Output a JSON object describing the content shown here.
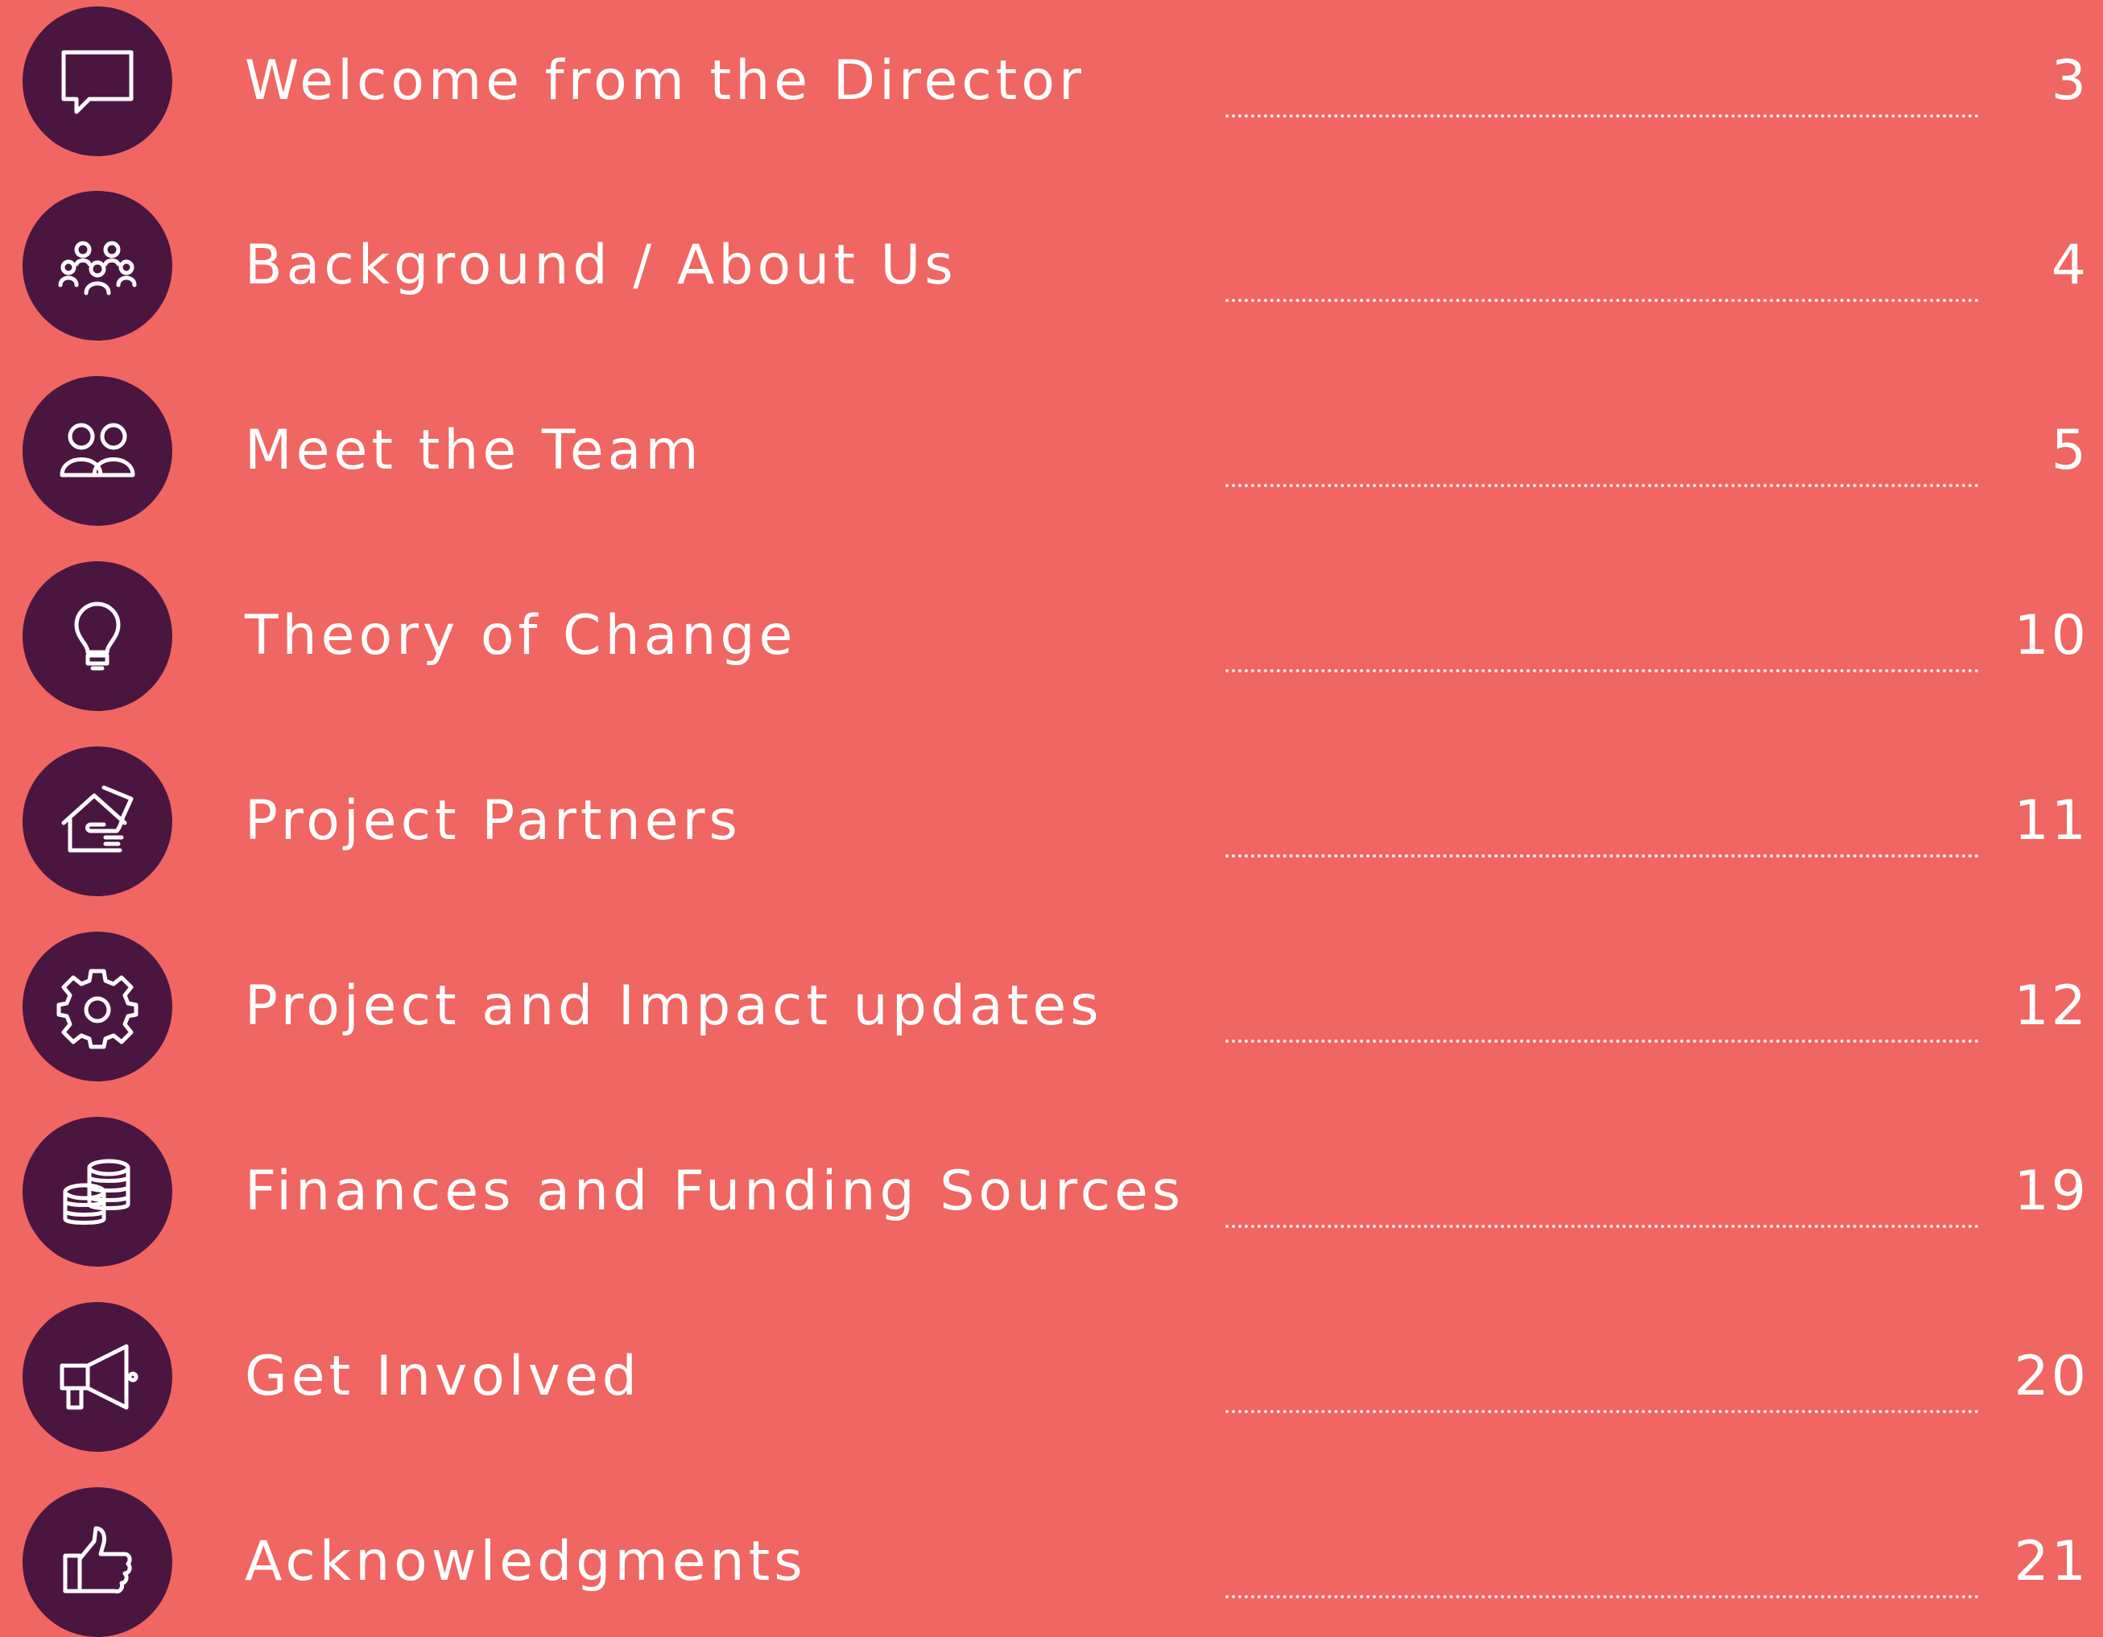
{
  "page": {
    "background_color": "#F06662",
    "circle_color": "#4A1640",
    "text_color": "#FFFFFF"
  },
  "toc": {
    "entries": [
      {
        "title": "Welcome from the Director",
        "page": "3",
        "icon": "speech-bubble-icon"
      },
      {
        "title": "Background / About Us",
        "page": "4",
        "icon": "community-group-icon"
      },
      {
        "title": "Meet the Team",
        "page": "5",
        "icon": "two-people-icon"
      },
      {
        "title": "Theory of Change",
        "page": "10",
        "icon": "lightbulb-icon"
      },
      {
        "title": "Project Partners",
        "page": "11",
        "icon": "hand-house-icon"
      },
      {
        "title": "Project and Impact updates",
        "page": "12",
        "icon": "gear-icon"
      },
      {
        "title": "Finances and Funding Sources",
        "page": "19",
        "icon": "coin-stacks-icon"
      },
      {
        "title": "Get Involved",
        "page": "20",
        "icon": "megaphone-icon"
      },
      {
        "title": "Acknowledgments",
        "page": "21",
        "icon": "thumbs-up-icon"
      }
    ]
  }
}
